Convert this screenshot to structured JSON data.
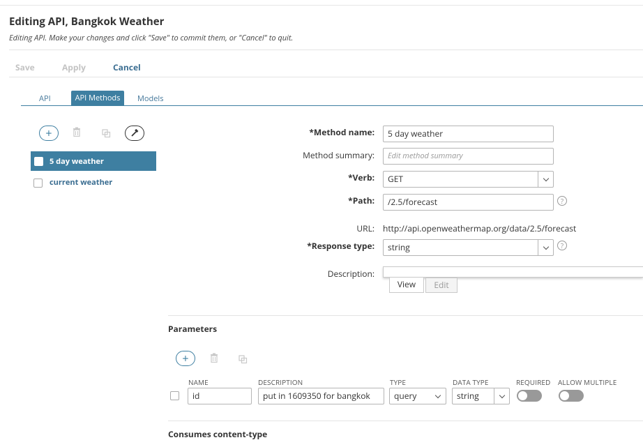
{
  "header": {
    "title": "Editing API, Bangkok Weather",
    "subtitle": "Editing API. Make your changes and click \"Save\" to commit them, or \"Cancel\" to quit."
  },
  "actions": {
    "save": "Save",
    "apply": "Apply",
    "cancel": "Cancel"
  },
  "tabs": [
    {
      "label": "API",
      "active": false
    },
    {
      "label": "API Methods",
      "active": true
    },
    {
      "label": "Models",
      "active": false
    }
  ],
  "toolbar_icons": [
    "add-icon",
    "delete-icon",
    "copy-icon",
    "tools-icon"
  ],
  "methods": [
    {
      "label": "5 day weather",
      "selected": true
    },
    {
      "label": "current weather",
      "selected": false
    }
  ],
  "form": {
    "method_name_label": "*Method name:",
    "method_name_value": "5 day weather",
    "summary_label": "Method summary:",
    "summary_placeholder": "Edit method summary",
    "verb_label": "*Verb:",
    "verb_value": "GET",
    "path_label": "*Path:",
    "path_value": "/2.5/forecast",
    "url_label": "URL:",
    "url_value": "http://api.openweathermap.org/data/2.5/forecast",
    "response_label": "*Response type:",
    "response_value": "string",
    "description_label": "Description:",
    "view_tab": "View",
    "edit_tab": "Edit",
    "help_glyph": "?"
  },
  "parameters": {
    "title": "Parameters",
    "columns": {
      "name": "NAME",
      "description": "DESCRIPTION",
      "type": "TYPE",
      "data_type": "DATA TYPE",
      "required": "REQUIRED",
      "allow_multiple": "ALLOW MULTIPLE"
    },
    "rows": [
      {
        "name": "id",
        "description": "put in 1609350 for bangkok",
        "type": "query",
        "data_type": "string",
        "required": false,
        "allow_multiple": false
      }
    ]
  },
  "consumes": {
    "title": "Consumes content-type"
  },
  "colors": {
    "accent": "#3e7fa1",
    "link": "#3a6d91",
    "disabled": "#c3c3c3",
    "toggle_off": "#999999"
  }
}
